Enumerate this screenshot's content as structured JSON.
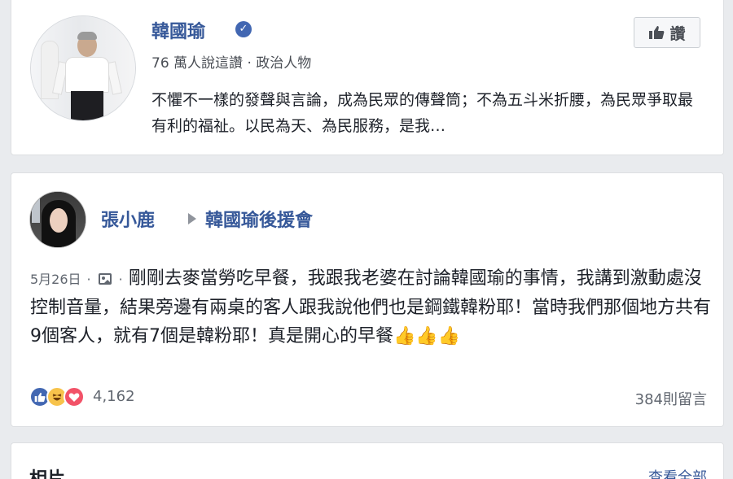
{
  "page": {
    "name": "韓國瑜",
    "meta": "76 萬人說這讚 · 政治人物",
    "description": "不懼不一樣的發聲與言論，成為民眾的傳聲筒；不為五斗米折腰，為民眾爭取最有利的福祉。以民為天、為民服務，是我…",
    "like_label": "讚"
  },
  "post": {
    "author": "張小鹿",
    "group": "韓國瑜後援會",
    "date": "5月26日",
    "separator": "·",
    "text": "剛剛去麥當勞吃早餐，我跟我老婆在討論韓國瑜的事情，我講到激動處沒控制音量，結果旁邊有兩桌的客人跟我說他們也是鋼鐵韓粉耶！當時我們那個地方共有9個客人，就有7個是韓粉耶！真是開心的早餐",
    "emoji": "👍👍👍",
    "reaction_count": "4,162",
    "comment_count": "384則留言",
    "reaction_icons": [
      "like-icon",
      "haha-icon",
      "love-icon"
    ]
  },
  "photos": {
    "title": "相片",
    "see_all": "查看全部"
  },
  "colors": {
    "link": "#365899",
    "background": "#e9ebee",
    "like_blue": "#4267b2",
    "love_red": "#f25268"
  }
}
